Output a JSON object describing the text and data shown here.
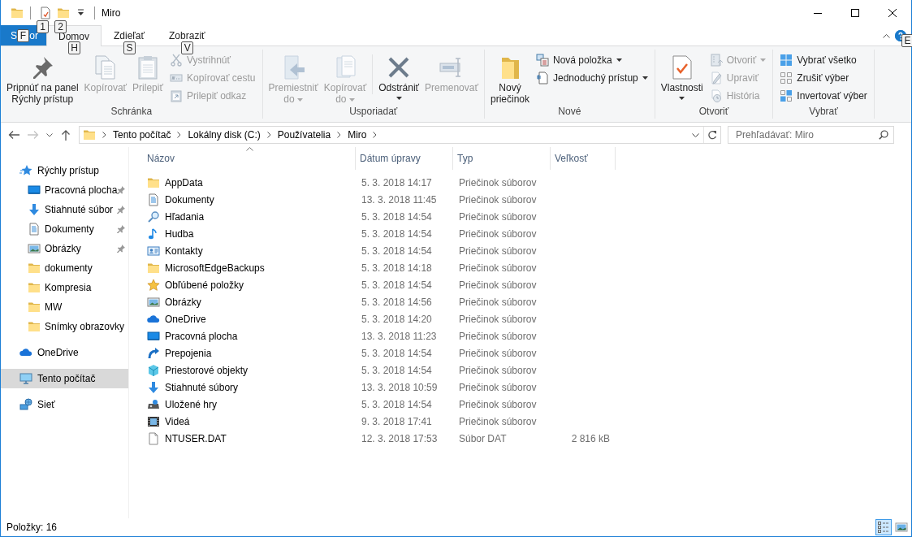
{
  "title_bar": {
    "title": "Miro",
    "quick_access": [
      {
        "kind": "folder"
      },
      {
        "kind": "properties_small",
        "keytip": "1"
      },
      {
        "kind": "folder",
        "keytip": "2"
      }
    ]
  },
  "ribbon": {
    "tabs": [
      {
        "kind": "file",
        "label": "S",
        "label_end": "or",
        "keytip": "F",
        "selected": false
      },
      {
        "kind": "tab",
        "label": "Domov",
        "keytip": "H",
        "selected": true
      },
      {
        "kind": "tab",
        "label": "Zdieľať",
        "keytip": "S",
        "selected": false
      },
      {
        "kind": "tab",
        "label": "Zobraziť",
        "keytip": "V",
        "selected": false
      }
    ],
    "help_keytip": "E",
    "groups": [
      {
        "label": "Schránka",
        "items": [
          {
            "kind": "pin",
            "lines": [
              "Pripnúť na panel",
              "Rýchly prístup"
            ],
            "disabled": false,
            "dropdown": false
          },
          {
            "kind": "copy",
            "lines": [
              "Kopírovať"
            ],
            "disabled": true,
            "dropdown": false
          },
          {
            "kind": "paste",
            "lines": [
              "Prilepiť"
            ],
            "disabled": true,
            "dropdown": false
          },
          {
            "kind": "stack",
            "items": [
              {
                "kind": "cut",
                "label": "Vystrihnúť",
                "disabled": true,
                "dropdown": false
              },
              {
                "kind": "copypath",
                "label": "Kopírovať cestu",
                "disabled": true,
                "dropdown": false
              },
              {
                "kind": "pasteshortcut",
                "label": "Prilepiť odkaz",
                "disabled": true,
                "dropdown": false
              }
            ]
          }
        ]
      },
      {
        "label": "Usporiadať",
        "items": [
          {
            "kind": "moveto",
            "lines": [
              "Premiestniť",
              "do"
            ],
            "disabled": true,
            "dropdown": true
          },
          {
            "kind": "copyto",
            "lines": [
              "Kopírovať",
              "do"
            ],
            "disabled": true,
            "dropdown": true
          },
          {
            "kind": "divider"
          },
          {
            "kind": "delete",
            "lines": [
              "Odstrániť"
            ],
            "disabled": false,
            "dropdown": true
          },
          {
            "kind": "rename",
            "lines": [
              "Premenovať"
            ],
            "disabled": true,
            "dropdown": false
          }
        ]
      },
      {
        "label": "Nové",
        "items": [
          {
            "kind": "newfolder",
            "lines": [
              "Nový",
              "priečinok"
            ],
            "disabled": false,
            "dropdown": false
          },
          {
            "kind": "stack",
            "items": [
              {
                "kind": "newitem",
                "label": "Nová položka",
                "disabled": false,
                "dropdown": true
              },
              {
                "kind": "easyaccess",
                "label": "Jednoduchý prístup",
                "disabled": false,
                "dropdown": true
              }
            ]
          }
        ]
      },
      {
        "label": "Otvoriť",
        "items": [
          {
            "kind": "properties",
            "lines": [
              "Vlastnosti"
            ],
            "disabled": false,
            "dropdown": true
          },
          {
            "kind": "stack",
            "items": [
              {
                "kind": "open",
                "label": "Otvoriť",
                "disabled": true,
                "dropdown": true
              },
              {
                "kind": "edit",
                "label": "Upraviť",
                "disabled": true,
                "dropdown": false
              },
              {
                "kind": "history",
                "label": "História",
                "disabled": true,
                "dropdown": false
              }
            ]
          }
        ]
      },
      {
        "label": "Vybrať",
        "items": [
          {
            "kind": "stack",
            "items": [
              {
                "kind": "selectall",
                "label": "Vybrať všetko",
                "disabled": false,
                "dropdown": false
              },
              {
                "kind": "selectnone",
                "label": "Zrušiť výber",
                "disabled": false,
                "dropdown": false
              },
              {
                "kind": "invert",
                "label": "Invertovať výber",
                "disabled": false,
                "dropdown": false
              }
            ]
          }
        ]
      }
    ]
  },
  "address_bar": {
    "forward_disabled": true,
    "path": [
      "Tento počítač",
      "Lokálny disk (C:)",
      "Používatelia",
      "Miro"
    ],
    "search": {
      "placeholder": "Prehľadávať: Miro"
    }
  },
  "navigation_pane": [
    {
      "label": "Rýchly prístup",
      "kind": "quickaccess",
      "selected": false,
      "children": [
        {
          "label": "Pracovná plocha",
          "kind": "desktop",
          "selected": false,
          "pinned": true
        },
        {
          "label": "Stiahnuté súbor",
          "kind": "download",
          "selected": false,
          "pinned": true
        },
        {
          "label": "Dokumenty",
          "kind": "doc",
          "selected": false,
          "pinned": true
        },
        {
          "label": "Obrázky",
          "kind": "pictures",
          "selected": false,
          "pinned": true
        },
        {
          "label": "dokumenty",
          "kind": "folder",
          "selected": false,
          "pinned": false
        },
        {
          "label": "Kompresia",
          "kind": "folder",
          "selected": false,
          "pinned": false
        },
        {
          "label": "MW",
          "kind": "folder",
          "selected": false,
          "pinned": false
        },
        {
          "label": "Snímky obrazovky",
          "kind": "folder",
          "selected": false,
          "pinned": false
        }
      ]
    },
    {
      "label": "OneDrive",
      "kind": "onedrive",
      "selected": false
    },
    {
      "label": "Tento počítač",
      "kind": "computer",
      "selected": true
    },
    {
      "label": "Sieť",
      "kind": "network",
      "selected": false
    }
  ],
  "file_list": {
    "columns": [
      {
        "label": "Názov",
        "sorted": true
      },
      {
        "label": "Dátum úpravy",
        "sorted": false
      },
      {
        "label": "Typ",
        "sorted": false
      },
      {
        "label": "Veľkosť",
        "sorted": false
      }
    ],
    "rows": [
      {
        "kind": "folder",
        "name": "AppData",
        "date": "5. 3. 2018 14:17",
        "type": "Priečinok súborov"
      },
      {
        "kind": "doc",
        "name": "Dokumenty",
        "date": "13. 3. 2018 11:45",
        "type": "Priečinok súborov"
      },
      {
        "kind": "search",
        "name": "Hľadania",
        "date": "5. 3. 2018 14:54",
        "type": "Priečinok súborov"
      },
      {
        "kind": "music",
        "name": "Hudba",
        "date": "5. 3. 2018 14:54",
        "type": "Priečinok súborov"
      },
      {
        "kind": "contacts",
        "name": "Kontakty",
        "date": "5. 3. 2018 14:54",
        "type": "Priečinok súborov"
      },
      {
        "kind": "folder",
        "name": "MicrosoftEdgeBackups",
        "date": "5. 3. 2018 14:18",
        "type": "Priečinok súborov"
      },
      {
        "kind": "star",
        "name": "Obľúbené položky",
        "date": "5. 3. 2018 14:54",
        "type": "Priečinok súborov"
      },
      {
        "kind": "pictures",
        "name": "Obrázky",
        "date": "5. 3. 2018 14:56",
        "type": "Priečinok súborov"
      },
      {
        "kind": "onedrive",
        "name": "OneDrive",
        "date": "5. 3. 2018 14:20",
        "type": "Priečinok súborov"
      },
      {
        "kind": "desktop",
        "name": "Pracovná plocha",
        "date": "13. 3. 2018 11:23",
        "type": "Priečinok súborov"
      },
      {
        "kind": "links",
        "name": "Prepojenia",
        "date": "5. 3. 2018 14:54",
        "type": "Priečinok súborov"
      },
      {
        "kind": "objects3d",
        "name": "Priestorové objekty",
        "date": "5. 3. 2018 14:54",
        "type": "Priečinok súborov"
      },
      {
        "kind": "download",
        "name": "Stiahnuté súbory",
        "date": "13. 3. 2018 10:59",
        "type": "Priečinok súborov"
      },
      {
        "kind": "games",
        "name": "Uložené hry",
        "date": "5. 3. 2018 14:54",
        "type": "Priečinok súborov"
      },
      {
        "kind": "video",
        "name": "Videá",
        "date": "9. 3. 2018 17:41",
        "type": "Priečinok súborov"
      },
      {
        "kind": "file",
        "name": "NTUSER.DAT",
        "date": "12. 3. 2018 17:53",
        "type": "Súbor DAT",
        "size": "2 816 kB"
      }
    ]
  },
  "status_bar": {
    "item_count": "Položky: 16",
    "views": [
      {
        "kind": "details",
        "selected": true
      },
      {
        "kind": "largeicons",
        "selected": false
      }
    ]
  }
}
